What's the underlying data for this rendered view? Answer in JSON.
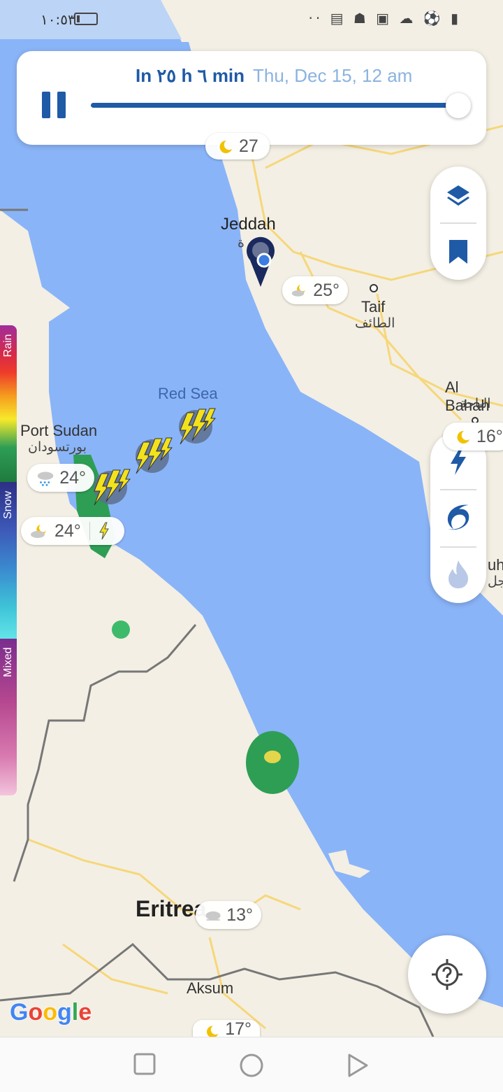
{
  "status_bar": {
    "time": "١٠:٥٣",
    "icons": "·· ▤ ☗ ▣ ☁ ⚽ ▮"
  },
  "timeline": {
    "relative_time": "In ٢٥ h ٦ min",
    "absolute_time": "Thu, Dec 15, 12 am",
    "progress": 1.0
  },
  "legend": {
    "rain": "Rain",
    "snow": "Snow",
    "mixed": "Mixed"
  },
  "map_labels": {
    "jeddah": "Jeddah",
    "jeddah_ar": "ة",
    "taif": "Taif",
    "taif_ar": "الطائف",
    "al_bahah": "Al Bahah",
    "al_bahah_ar": "الباحة",
    "red_sea": "Red Sea",
    "port_sudan": "Port Sudan",
    "port_sudan_ar": "بورتسودان",
    "eritrea": "Eritrea",
    "aksum": "Aksum",
    "right_edge": "uh",
    "right_edge_ar": "جل"
  },
  "temperatures": {
    "top": "27",
    "jeddah": "25°",
    "al_bahah": "16°",
    "port_sudan_1": "24°",
    "port_sudan_2": "24°",
    "eritrea": "13°",
    "bottom": "17°"
  },
  "attribution": "Google",
  "colors": {
    "accent": "#1f5aa6",
    "sea": "#8ab4f8",
    "land": "#f3efe4"
  }
}
